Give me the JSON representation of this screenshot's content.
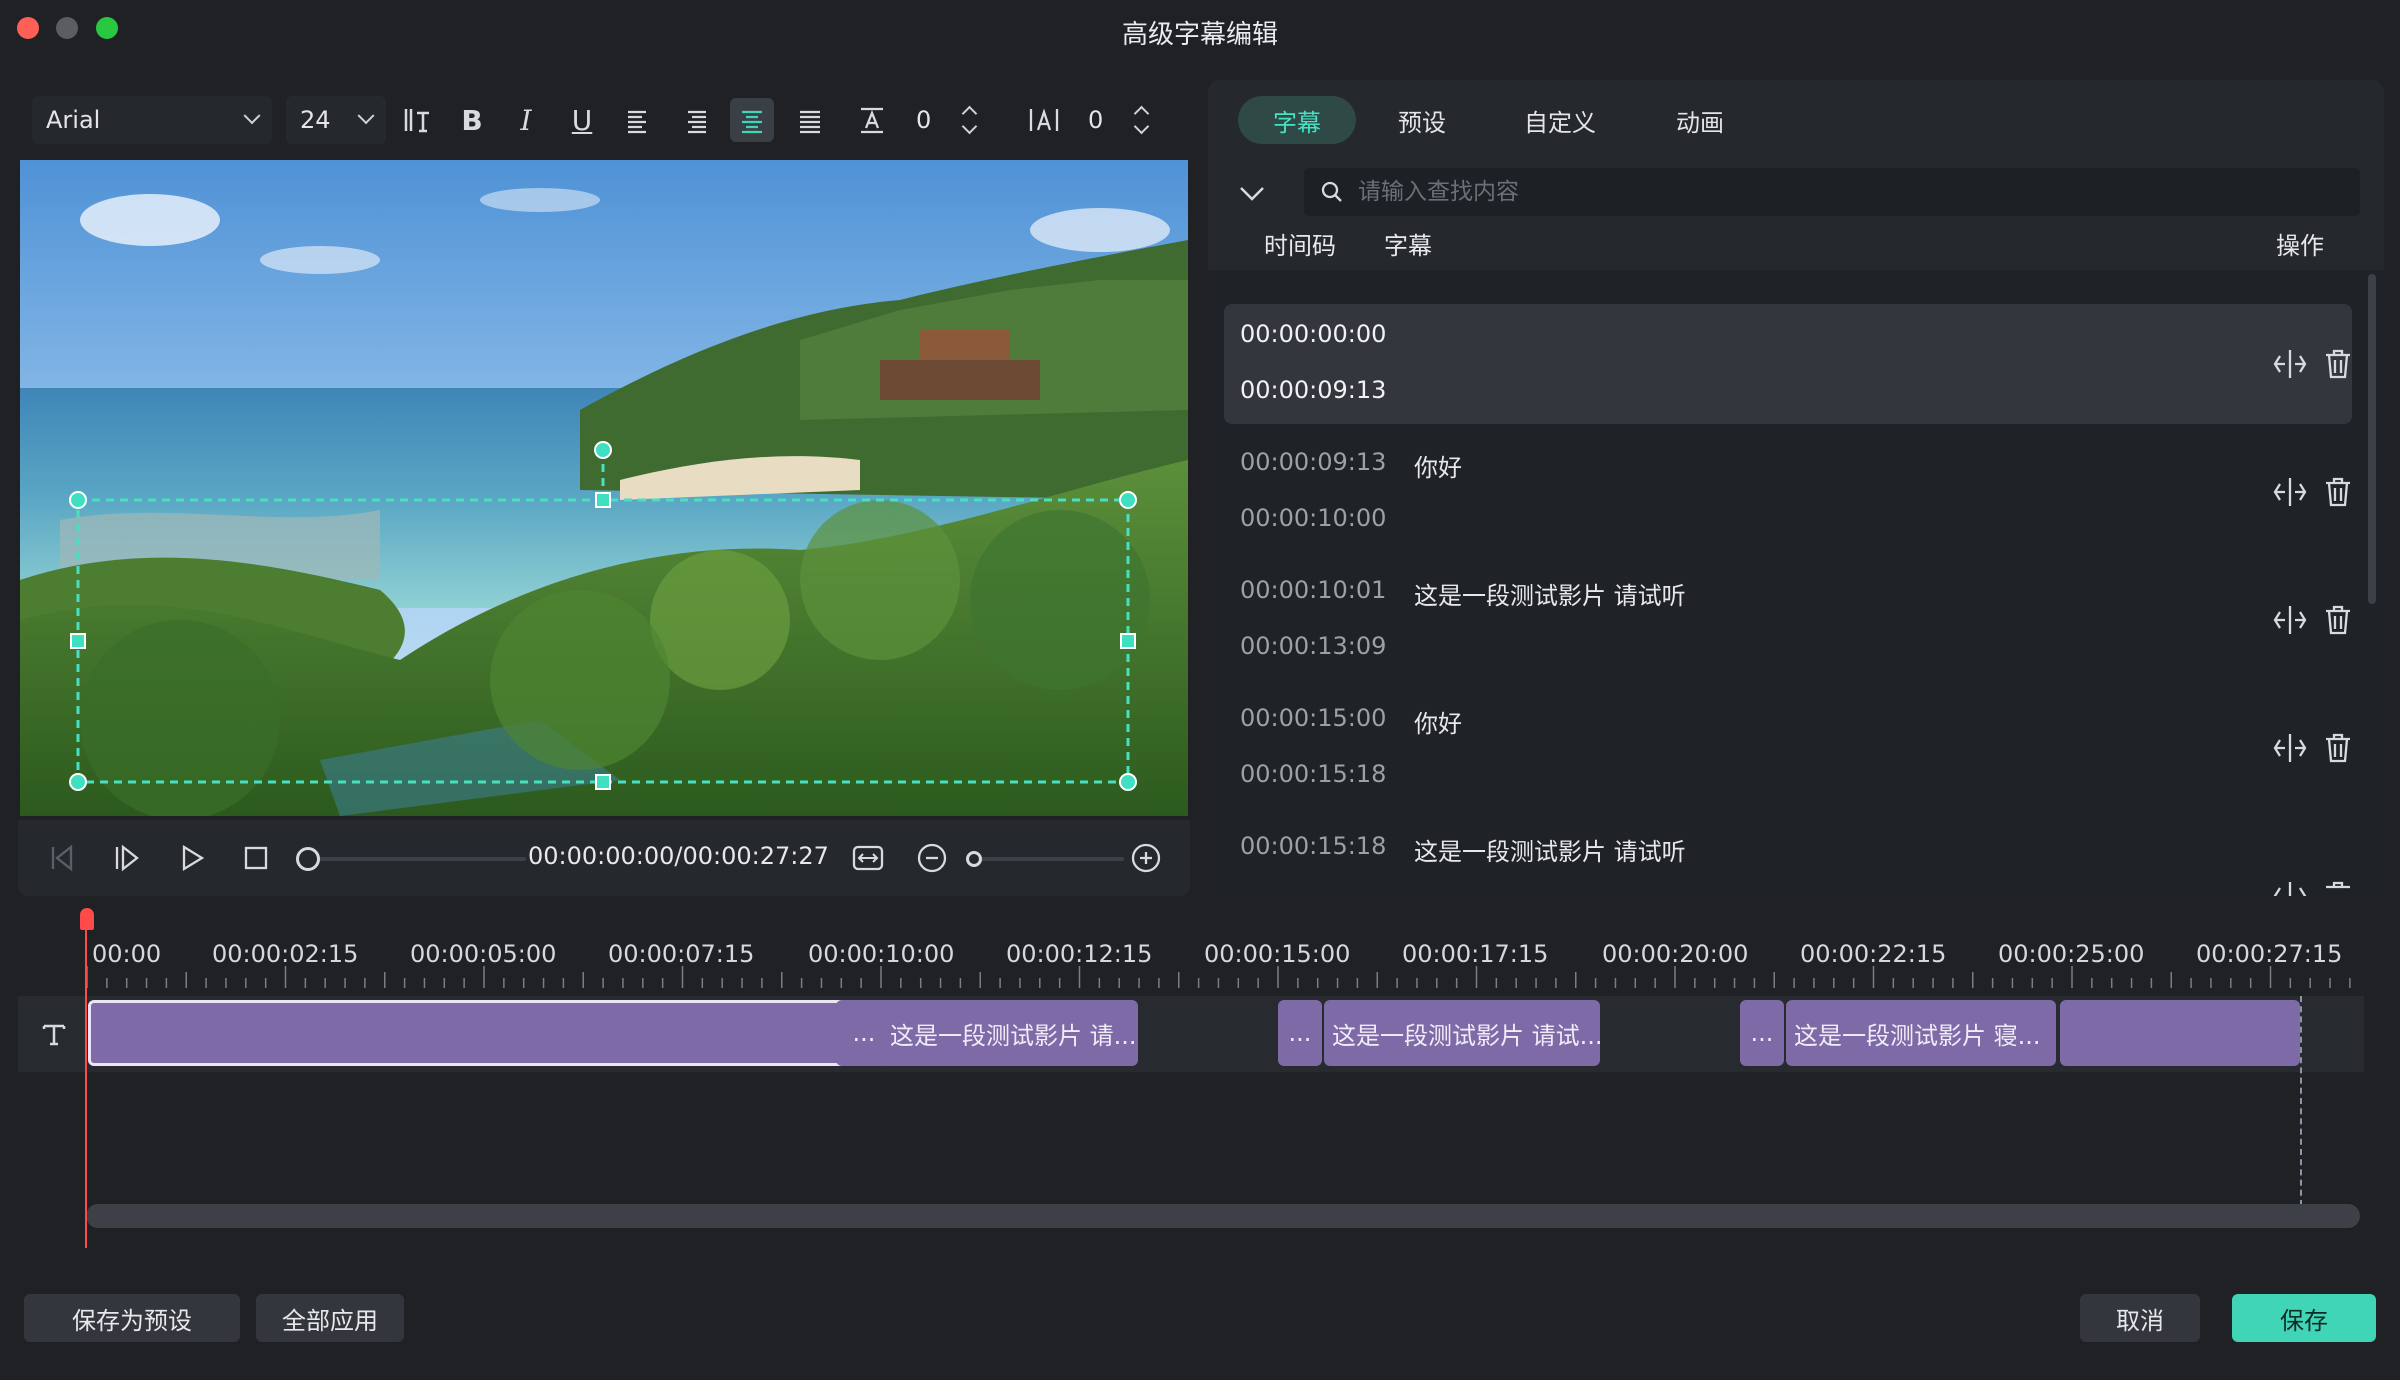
{
  "window": {
    "title": "高级字幕编辑"
  },
  "toolbar": {
    "font": "Arial",
    "size": "24",
    "line_spacing": "0",
    "letter_spacing": "0"
  },
  "player": {
    "timecode": "00:00:00:00/00:00:27:27",
    "progress": 0,
    "zoom": 0
  },
  "panel": {
    "tabs": [
      "字幕",
      "预设",
      "自定义",
      "动画"
    ],
    "active_tab": 0,
    "search_placeholder": "请输入查找内容",
    "columns": {
      "timecode": "时间码",
      "subtitle": "字幕",
      "action": "操作"
    },
    "rows": [
      {
        "start": "00:00:00:00",
        "end": "00:00:09:13",
        "text": ""
      },
      {
        "start": "00:00:09:13",
        "end": "00:00:10:00",
        "text": "你好"
      },
      {
        "start": "00:00:10:01",
        "end": "00:00:13:09",
        "text": "这是一段测试影片 请试听"
      },
      {
        "start": "00:00:15:00",
        "end": "00:00:15:18",
        "text": "你好"
      },
      {
        "start": "00:00:15:18",
        "end": "",
        "text": "这是一段测试影片 请试听"
      }
    ]
  },
  "timeline": {
    "ruler": [
      "00:00",
      "00:00:02:15",
      "00:00:05:00",
      "00:00:07:15",
      "00:00:10:00",
      "00:00:12:15",
      "00:00:15:00",
      "00:00:17:15",
      "00:00:20:00",
      "00:00:22:15",
      "00:00:25:00",
      "00:00:27:15"
    ],
    "clips": [
      "",
      "...",
      "这是一段测试影片 请...",
      "...",
      "这是一段测试影片 请试...",
      "...",
      "这是一段测试影片 寝...",
      ""
    ]
  },
  "footer": {
    "save_preset": "保存为预设",
    "apply_all": "全部应用",
    "cancel": "取消",
    "save": "保存"
  },
  "colors": {
    "accent": "#40d5b6",
    "clip": "#7e6aa7",
    "playhead": "#ff4a4a"
  }
}
